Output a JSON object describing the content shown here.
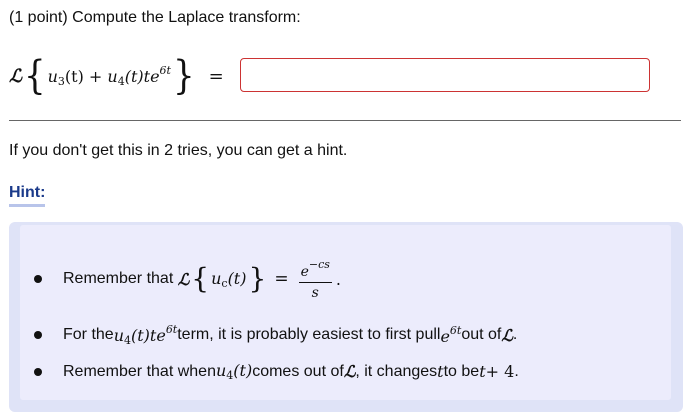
{
  "question": {
    "prefix": "(1 point) Compute the Laplace transform:",
    "operator": "ℒ",
    "expression": {
      "u1": "u",
      "u1_sub": "3",
      "arg1": "(t) + ",
      "u2": "u",
      "u2_sub": "4",
      "arg2": "(t)te",
      "exp": "6t"
    },
    "equals": "="
  },
  "answer": {
    "value": "",
    "placeholder": ""
  },
  "try_note": "If you don't get this in 2 tries, you can get a hint.",
  "hint": {
    "label": "Hint:",
    "items": [
      {
        "text_before": "Remember that",
        "op": "ℒ",
        "u": "u",
        "u_sub": "c",
        "arg": "(t)",
        "eq": "=",
        "num_base": "e",
        "num_exp": "−cs",
        "den": "s",
        "end": "."
      },
      {
        "t1": "For the ",
        "u": "u",
        "u_sub": "4",
        "t2": "(t)te",
        "exp": "6t",
        "t3": " term, it is probably easiest to first pull ",
        "e": "e",
        "exp2": "6t",
        "t4": " out of ",
        "op": "ℒ",
        "end": "."
      },
      {
        "t1": "Remember that when ",
        "u": "u",
        "u_sub": "4",
        "t2": "(t)",
        "t3": " comes out of ",
        "op": "ℒ",
        "t4": ", it changes ",
        "var1": "t",
        "t5": " to be ",
        "var2": "t",
        "t6": " + 4",
        "end": "."
      }
    ]
  },
  "colors": {
    "hint_panel": "#dfe3f7",
    "hint_inner": "#ececfc",
    "input_border": "#cc3333",
    "link": "#1a3a8a"
  }
}
